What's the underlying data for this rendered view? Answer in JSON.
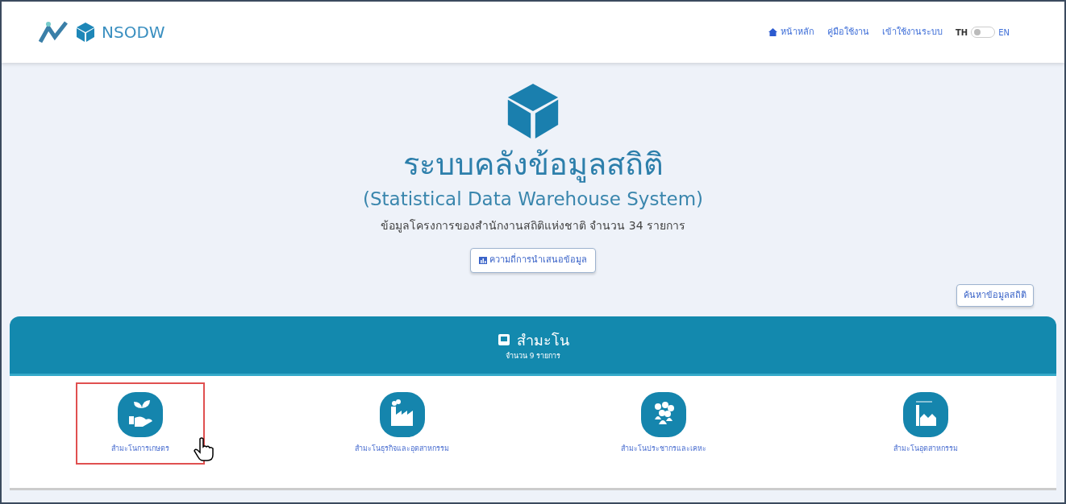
{
  "brand": {
    "name": "NSODW"
  },
  "nav": {
    "links": [
      {
        "label": "หน้าหลัก",
        "kind": "home"
      },
      {
        "label": "คู่มือใช้งาน",
        "kind": "plain"
      },
      {
        "label": "เข้าใช้งานระบบ",
        "kind": "plain"
      }
    ],
    "language": {
      "left": "TH",
      "right": "EN",
      "on": false
    }
  },
  "hero": {
    "title": "ระบบคลังข้อมูลสถิติ",
    "subtitle": "(Statistical Data Warehouse System)",
    "summary": "ข้อมูลโครงการของสำนักงานสถิติแห่งชาติ จำนวน 34 รายการ",
    "frequency_button": "ความถี่การนำเสนอข้อมูล",
    "search_button": "ค้นหาข้อมูลสถิติ"
  },
  "category": {
    "title": "สำมะโน",
    "count": "จำนวน 9 รายการ",
    "items": [
      {
        "label": "สำมะโนการเกษตร",
        "kind": "agriculture",
        "selected": true
      },
      {
        "label": "สำมะโนธุรกิจและอุตสาหกรรม",
        "kind": "factory",
        "selected": false
      },
      {
        "label": "สำมะโนประชากรและเคหะ",
        "kind": "people",
        "selected": false
      },
      {
        "label": "สำมะโนอุตสาหกรรม",
        "kind": "industry",
        "selected": false
      }
    ]
  }
}
